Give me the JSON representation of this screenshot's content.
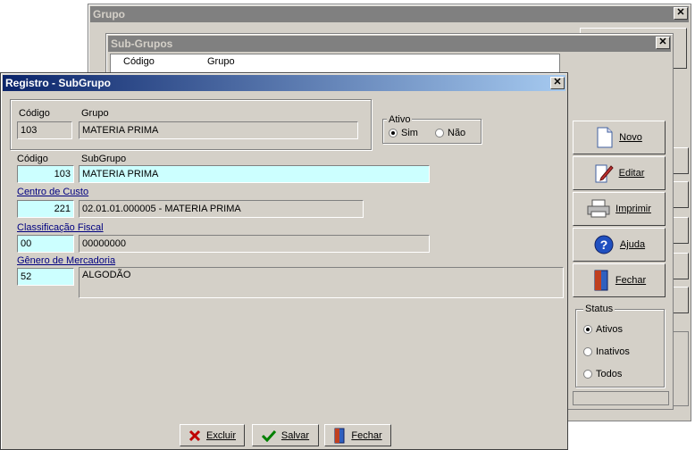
{
  "grupo_window": {
    "title": "Grupo",
    "close": "✕"
  },
  "subgrupos_window": {
    "title": "Sub-Grupos",
    "close": "✕",
    "col_codigo": "Código",
    "col_grupo": "Grupo",
    "buttons": {
      "novo": "Novo",
      "editar": "Editar",
      "imprimir": "Imprimir",
      "ajuda": "Ajuda",
      "fechar": "Fechar"
    },
    "status": {
      "title": "Status",
      "options": [
        "Ativos",
        "Inativos",
        "Todos"
      ],
      "selected": "Ativos"
    }
  },
  "registro_dialog": {
    "title": "Registro - SubGrupo",
    "close": "✕",
    "grupo": {
      "codigo_label": "Código",
      "grupo_label": "Grupo",
      "codigo": "103",
      "grupo": "MATERIA PRIMA"
    },
    "ativo": {
      "label": "Ativo",
      "sim": "Sim",
      "nao": "Não",
      "selected": "Sim"
    },
    "subgrupo": {
      "codigo_label": "Código",
      "subgrupo_label": "SubGrupo",
      "codigo": "103",
      "subgrupo": "MATERIA PRIMA"
    },
    "centro_custo": {
      "label": "Centro de Custo",
      "codigo": "221",
      "descricao": "02.01.01.000005 - MATERIA PRIMA"
    },
    "classificacao_fiscal": {
      "label": "Classificação Fiscal",
      "codigo": "00",
      "descricao": "00000000"
    },
    "genero_mercadoria": {
      "label": "Gênero de Mercadoria",
      "codigo": "52",
      "descricao": "ALGODÃO"
    },
    "buttons": {
      "excluir": "Excluir",
      "salvar": "Salvar",
      "fechar": "Fechar"
    }
  },
  "colors": {
    "active_title": "#0a246a",
    "inactive_title": "#808080",
    "face": "#d4d0c8",
    "cyan_field": "#ccffff"
  },
  "icons": [
    "close-icon",
    "document-icon",
    "pencil-icon",
    "printer-icon",
    "help-icon",
    "door-icon",
    "x-icon",
    "check-icon"
  ]
}
